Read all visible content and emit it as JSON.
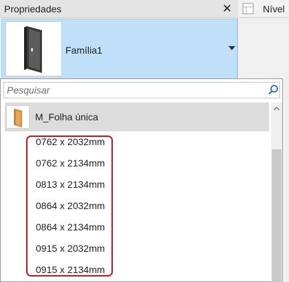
{
  "panel": {
    "title": "Propriedades",
    "close_glyph": "✕"
  },
  "type_selector": {
    "name": "Família1",
    "icon": "door-preview-icon"
  },
  "search": {
    "placeholder": "Pesquisar",
    "value": ""
  },
  "family_group": {
    "label": "M_Folha única",
    "icon": "door-family-icon"
  },
  "types": [
    "0762 x 2032mm",
    "0762 x 2134mm",
    "0813 x 2134mm",
    "0864 x 2032mm",
    "0864 x 2134mm",
    "0915 x 2032mm",
    "0915 x 2134mm"
  ],
  "right_tab": {
    "label": "Nível"
  },
  "colors": {
    "highlight": "#c0191d",
    "selector_bg": "#bfe0f8",
    "search_icon": "#1e6fbf"
  }
}
